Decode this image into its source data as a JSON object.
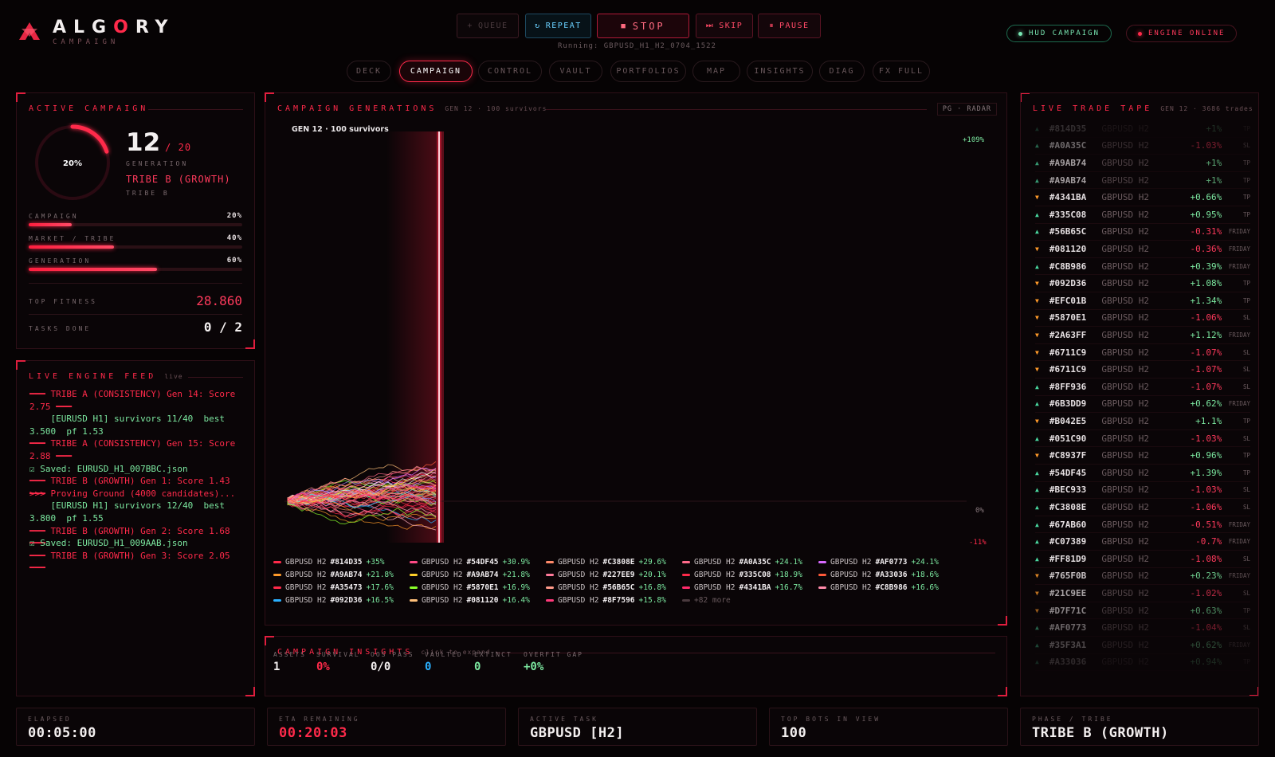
{
  "brand": {
    "logo_pre": "ALG",
    "logo_o": "O",
    "logo_post": "RY",
    "subtitle": "CAMPAIGN"
  },
  "controls": {
    "queue": "QUEUE",
    "repeat": "REPEAT",
    "stop": "STOP",
    "skip": "SKIP",
    "pause": "PAUSE",
    "running": "Running: GBPUSD_H1_H2_0704_1522"
  },
  "status": {
    "hud": "HUD CAMPAIGN",
    "engine": "ENGINE ONLINE"
  },
  "tabs": [
    "DECK",
    "CAMPAIGN",
    "CONTROL",
    "VAULT",
    "PORTFOLIOS",
    "MAP",
    "INSIGHTS",
    "DIAG",
    "FX FULL"
  ],
  "active_tab": "CAMPAIGN",
  "active_campaign": {
    "title": "ACTIVE CAMPAIGN",
    "ring_pct": "20%",
    "ring_value": 0.2,
    "generation": "12",
    "generation_of": "/ 20",
    "generation_label": "GENERATION",
    "tribe": "TRIBE B (GROWTH)",
    "tribe_sub": "TRIBE B",
    "bars": [
      {
        "label": "CAMPAIGN",
        "pct": "20%",
        "value": 0.2
      },
      {
        "label": "MARKET / TRIBE",
        "pct": "40%",
        "value": 0.4
      },
      {
        "label": "GENERATION",
        "pct": "60%",
        "value": 0.6
      }
    ],
    "top_fitness_label": "TOP FITNESS",
    "top_fitness": "28.860",
    "tasks_label": "TASKS DONE",
    "tasks": "0 / 2"
  },
  "feed": {
    "title": "LIVE ENGINE FEED",
    "sub": "live",
    "lines": [
      {
        "t": "━━━ TRIBE A (CONSISTENCY) Gen 14: Score",
        "c": "r"
      },
      {
        "t": "2.75 ━━━",
        "c": "r"
      },
      {
        "t": "    [EURUSD H1] survivors 11/40  best",
        "c": "g"
      },
      {
        "t": "3.500  pf 1.53",
        "c": "g"
      },
      {
        "t": "━━━ TRIBE A (CONSISTENCY) Gen 15: Score",
        "c": "r"
      },
      {
        "t": "2.88 ━━━",
        "c": "r"
      },
      {
        "t": "☑ Saved: EURUSD_H1_007BBC.json",
        "c": "g"
      },
      {
        "t": "━━━ TRIBE B (GROWTH) Gen 1: Score 1.43 ━━━",
        "c": "r"
      },
      {
        "t": ">>> Proving Ground (4000 candidates)...",
        "c": "r"
      },
      {
        "t": "    [EURUSD H1] survivors 12/40  best",
        "c": "g"
      },
      {
        "t": "3.800  pf 1.55",
        "c": "g"
      },
      {
        "t": "━━━ TRIBE B (GROWTH) Gen 2: Score 1.68 ━━━",
        "c": "r"
      },
      {
        "t": "☑ Saved: EURUSD_H1_009AAB.json",
        "c": "g"
      },
      {
        "t": "━━━ TRIBE B (GROWTH) Gen 3: Score 2.05 ━━━",
        "c": "r"
      }
    ]
  },
  "generations": {
    "title": "CAMPAIGN GENERATIONS",
    "sub": "GEN 12 · 100 survivors",
    "mode": "PG · RADAR",
    "chart_label": "GEN 12 · 100 survivors",
    "top_label": "+109%",
    "zero_label": "0%",
    "bottom_label": "-11%",
    "legend": [
      {
        "pair": "GBPUSD H2",
        "hash": "#814D35",
        "pct": "+35%",
        "color": "#ff2a4a"
      },
      {
        "pair": "GBPUSD H2",
        "hash": "#54DF45",
        "pct": "+30.9%",
        "color": "#ff4a86"
      },
      {
        "pair": "GBPUSD H2",
        "hash": "#C3808E",
        "pct": "+29.6%",
        "color": "#ff8a6a"
      },
      {
        "pair": "GBPUSD H2",
        "hash": "#A0A35C",
        "pct": "+24.1%",
        "color": "#ff6a8a"
      },
      {
        "pair": "GBPUSD H2",
        "hash": "#AF0773",
        "pct": "+24.1%",
        "color": "#d86aff"
      },
      {
        "pair": "GBPUSD H2",
        "hash": "#A9AB74",
        "pct": "+21.8%",
        "color": "#ff9a2a"
      },
      {
        "pair": "GBPUSD H2",
        "hash": "#A9AB74",
        "pct": "+21.8%",
        "color": "#ffd02a"
      },
      {
        "pair": "GBPUSD H2",
        "hash": "#227EE9",
        "pct": "+20.1%",
        "color": "#ff7a9a"
      },
      {
        "pair": "GBPUSD H2",
        "hash": "#335C08",
        "pct": "+18.9%",
        "color": "#ff2a4a"
      },
      {
        "pair": "GBPUSD H2",
        "hash": "#A33036",
        "pct": "+18.6%",
        "color": "#ff5a3a"
      },
      {
        "pair": "GBPUSD H2",
        "hash": "#A35473",
        "pct": "+17.6%",
        "color": "#ff2a4a"
      },
      {
        "pair": "GBPUSD H2",
        "hash": "#5870E1",
        "pct": "+16.9%",
        "color": "#8aff2a"
      },
      {
        "pair": "GBPUSD H2",
        "hash": "#56B65C",
        "pct": "+16.8%",
        "color": "#ff9a8a"
      },
      {
        "pair": "GBPUSD H2",
        "hash": "#4341BA",
        "pct": "+16.7%",
        "color": "#ff2a6a"
      },
      {
        "pair": "GBPUSD H2",
        "hash": "#C8B986",
        "pct": "+16.6%",
        "color": "#ff8aaa"
      },
      {
        "pair": "GBPUSD H2",
        "hash": "#092D36",
        "pct": "+16.5%",
        "color": "#2ab0ff"
      },
      {
        "pair": "GBPUSD H2",
        "hash": "#081120",
        "pct": "+16.4%",
        "color": "#ffc07a"
      },
      {
        "pair": "GBPUSD H2",
        "hash": "#8F7596",
        "pct": "+15.8%",
        "color": "#ff3a7a"
      }
    ],
    "more": "+82 more"
  },
  "insights": {
    "title": "CAMPAIGN INSIGHTS",
    "sub": "click to expand ▸",
    "items": [
      {
        "label": "ASSETS",
        "value": "1",
        "color": "#f4f0f0"
      },
      {
        "label": "SURVIVAL",
        "value": "0%",
        "color": "#ff2a4a"
      },
      {
        "label": "OOS PASS",
        "value": "0/0",
        "color": "#f4f0f0"
      },
      {
        "label": "VAULTED",
        "value": "0",
        "color": "#2ab0ff"
      },
      {
        "label": "EXTINCT",
        "value": "0",
        "color": "#7ce8a0"
      },
      {
        "label": "OVERFIT GAP",
        "value": "+0%",
        "color": "#7ce8a0"
      }
    ]
  },
  "tape": {
    "title": "LIVE TRADE TAPE",
    "sub": "GEN 12 · 3686 trades",
    "rows": [
      {
        "dir": "up",
        "hash": "#814D35",
        "pair": "GBPUSD H2",
        "val": "+1%",
        "tag": "TP"
      },
      {
        "dir": "up",
        "hash": "#A0A35C",
        "pair": "GBPUSD H2",
        "val": "-1.03%",
        "tag": "SL"
      },
      {
        "dir": "up",
        "hash": "#A9AB74",
        "pair": "GBPUSD H2",
        "val": "+1%",
        "tag": "TP"
      },
      {
        "dir": "up",
        "hash": "#A9AB74",
        "pair": "GBPUSD H2",
        "val": "+1%",
        "tag": "TP"
      },
      {
        "dir": "down",
        "hash": "#4341BA",
        "pair": "GBPUSD H2",
        "val": "+0.66%",
        "tag": "TP"
      },
      {
        "dir": "up",
        "hash": "#335C08",
        "pair": "GBPUSD H2",
        "val": "+0.95%",
        "tag": "TP"
      },
      {
        "dir": "up",
        "hash": "#56B65C",
        "pair": "GBPUSD H2",
        "val": "-0.31%",
        "tag": "FRIDAY"
      },
      {
        "dir": "down",
        "hash": "#081120",
        "pair": "GBPUSD H2",
        "val": "-0.36%",
        "tag": "FRIDAY"
      },
      {
        "dir": "up",
        "hash": "#C8B986",
        "pair": "GBPUSD H2",
        "val": "+0.39%",
        "tag": "FRIDAY"
      },
      {
        "dir": "down",
        "hash": "#092D36",
        "pair": "GBPUSD H2",
        "val": "+1.08%",
        "tag": "TP"
      },
      {
        "dir": "down",
        "hash": "#EFC01B",
        "pair": "GBPUSD H2",
        "val": "+1.34%",
        "tag": "TP"
      },
      {
        "dir": "down",
        "hash": "#5870E1",
        "pair": "GBPUSD H2",
        "val": "-1.06%",
        "tag": "SL"
      },
      {
        "dir": "down",
        "hash": "#2A63FF",
        "pair": "GBPUSD H2",
        "val": "+1.12%",
        "tag": "FRIDAY"
      },
      {
        "dir": "down",
        "hash": "#6711C9",
        "pair": "GBPUSD H2",
        "val": "-1.07%",
        "tag": "SL"
      },
      {
        "dir": "down",
        "hash": "#6711C9",
        "pair": "GBPUSD H2",
        "val": "-1.07%",
        "tag": "SL"
      },
      {
        "dir": "up",
        "hash": "#8FF936",
        "pair": "GBPUSD H2",
        "val": "-1.07%",
        "tag": "SL"
      },
      {
        "dir": "up",
        "hash": "#6B3DD9",
        "pair": "GBPUSD H2",
        "val": "+0.62%",
        "tag": "FRIDAY"
      },
      {
        "dir": "down",
        "hash": "#B042E5",
        "pair": "GBPUSD H2",
        "val": "+1.1%",
        "tag": "TP"
      },
      {
        "dir": "up",
        "hash": "#051C90",
        "pair": "GBPUSD H2",
        "val": "-1.03%",
        "tag": "SL"
      },
      {
        "dir": "down",
        "hash": "#C8937F",
        "pair": "GBPUSD H2",
        "val": "+0.96%",
        "tag": "TP"
      },
      {
        "dir": "up",
        "hash": "#54DF45",
        "pair": "GBPUSD H2",
        "val": "+1.39%",
        "tag": "TP"
      },
      {
        "dir": "up",
        "hash": "#BEC933",
        "pair": "GBPUSD H2",
        "val": "-1.03%",
        "tag": "SL"
      },
      {
        "dir": "up",
        "hash": "#C3808E",
        "pair": "GBPUSD H2",
        "val": "-1.06%",
        "tag": "SL"
      },
      {
        "dir": "up",
        "hash": "#67AB60",
        "pair": "GBPUSD H2",
        "val": "-0.51%",
        "tag": "FRIDAY"
      },
      {
        "dir": "up",
        "hash": "#C07389",
        "pair": "GBPUSD H2",
        "val": "-0.7%",
        "tag": "FRIDAY"
      },
      {
        "dir": "up",
        "hash": "#FF81D9",
        "pair": "GBPUSD H2",
        "val": "-1.08%",
        "tag": "SL"
      },
      {
        "dir": "down",
        "hash": "#765F0B",
        "pair": "GBPUSD H2",
        "val": "+0.23%",
        "tag": "FRIDAY"
      },
      {
        "dir": "down",
        "hash": "#21C9EE",
        "pair": "GBPUSD H2",
        "val": "-1.02%",
        "tag": "SL"
      },
      {
        "dir": "down",
        "hash": "#D7F71C",
        "pair": "GBPUSD H2",
        "val": "+0.63%",
        "tag": "TP"
      },
      {
        "dir": "up",
        "hash": "#AF0773",
        "pair": "GBPUSD H2",
        "val": "-1.04%",
        "tag": "SL"
      },
      {
        "dir": "up",
        "hash": "#35F3A1",
        "pair": "GBPUSD H2",
        "val": "+0.62%",
        "tag": "FRIDAY"
      },
      {
        "dir": "up",
        "hash": "#A33036",
        "pair": "GBPUSD H2",
        "val": "+0.94%",
        "tag": "TP"
      }
    ]
  },
  "footer": [
    {
      "label": "ELAPSED",
      "value": "00:05:00",
      "color": "#f4f0f0"
    },
    {
      "label": "ETA REMAINING",
      "value": "00:20:03",
      "color": "#ff2a4a"
    },
    {
      "label": "ACTIVE TASK",
      "value": "GBPUSD [H2]",
      "color": "#f4f0f0"
    },
    {
      "label": "TOP BOTS IN VIEW",
      "value": "100",
      "color": "#f4f0f0"
    },
    {
      "label": "PHASE / TRIBE",
      "value": "TRIBE B (GROWTH)",
      "color": "#f4f0f0"
    }
  ],
  "colors": {
    "accent": "#ff2a4a",
    "positive": "#7ce8a0",
    "info": "#2ab0ff",
    "warn": "#ff9a2a",
    "bg": "#060304"
  }
}
